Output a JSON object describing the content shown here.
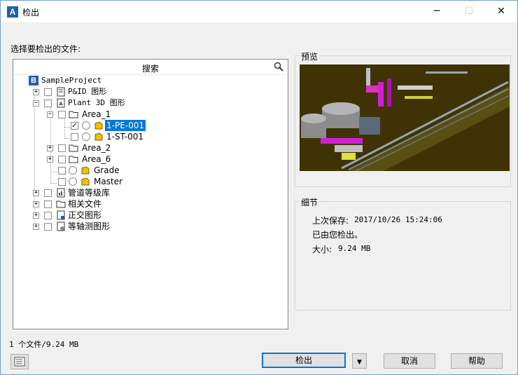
{
  "window": {
    "title": "检出",
    "app_icon": "A",
    "minimize": "─",
    "maximize": "☐",
    "close": "✕"
  },
  "instruction": "选择要检出的文件:",
  "search": {
    "label": "搜索"
  },
  "tree": {
    "root": "SampleProject",
    "pid": "P&ID 图形",
    "plant3d": "Plant 3D 图形",
    "area1": "Area_1",
    "file1": "1-PE-001",
    "file2": "1-ST-001",
    "area2": "Area_2",
    "area6": "Area_6",
    "grade": "Grade",
    "master": "Master",
    "spec": "管道等级库",
    "related": "相关文件",
    "ortho": "正交图形",
    "iso": "等轴测图形"
  },
  "preview": {
    "label": "预览"
  },
  "details": {
    "label": "细节",
    "saved_label": "上次保存:",
    "saved_value": "2017/10/26 15:24:06",
    "checked_out": "已由您检出。",
    "size_label": "大小:",
    "size_value": "9.24 MB"
  },
  "status": "1 个文件/9.24 MB",
  "buttons": {
    "checkout": "检出",
    "cancel": "取消",
    "help": "帮助"
  },
  "colors": {
    "selection": "#0078d7",
    "preview_bg": "#3f3306",
    "app_icon": "#1f5fb0"
  }
}
